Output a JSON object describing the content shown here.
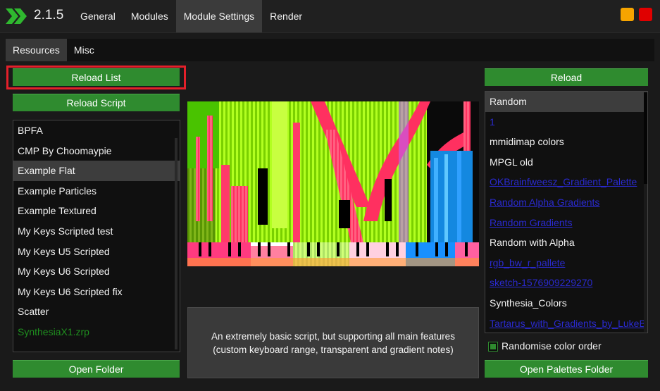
{
  "app": {
    "version": "2.1.5",
    "menu": [
      "General",
      "Modules",
      "Module Settings",
      "Render"
    ],
    "active_menu": "Module Settings",
    "colors": {
      "accent": "#2f8b2f",
      "minimize": "#f6a400",
      "close": "#e00000",
      "highlight": "#e4202a"
    }
  },
  "subtabs": [
    "Resources",
    "Misc"
  ],
  "left": {
    "reload_list_label": "Reload List",
    "reload_script_label": "Reload Script",
    "scripts": [
      "BPFA",
      "CMP By Choomaypie",
      "Example Flat",
      "Example Particles",
      "Example Textured",
      "My Keys  Scripted test",
      "My Keys U5 Scripted",
      "My Keys U6 Scripted",
      "My Keys U6 Scripted fix",
      "Scatter",
      "SynthesiaX1.zrp"
    ],
    "selected_script": "Example Flat",
    "open_folder_label": "Open Folder"
  },
  "center": {
    "description_line1": "An extremely basic script, but supporting all main features",
    "description_line2": "(custom keyboard range, transparent and gradient notes)"
  },
  "right": {
    "reload_label": "Reload",
    "palettes": [
      "Random",
      "1",
      "mmidimap colors",
      "MPGL old",
      "OKBrainfweesz_Gradient_Palette",
      "Random Alpha Gradients",
      "Random Gradients",
      "Random with Alpha",
      "rgb_bw_r_pallete",
      "sketch-1576909229270",
      "Synthesia_Colors",
      "Tartarus_with_Gradients_by_LukeBee"
    ],
    "selected_palette": "Random",
    "randomise_label": "Randomise color order",
    "randomise_checked": true,
    "open_palettes_label": "Open Palettes Folder"
  }
}
